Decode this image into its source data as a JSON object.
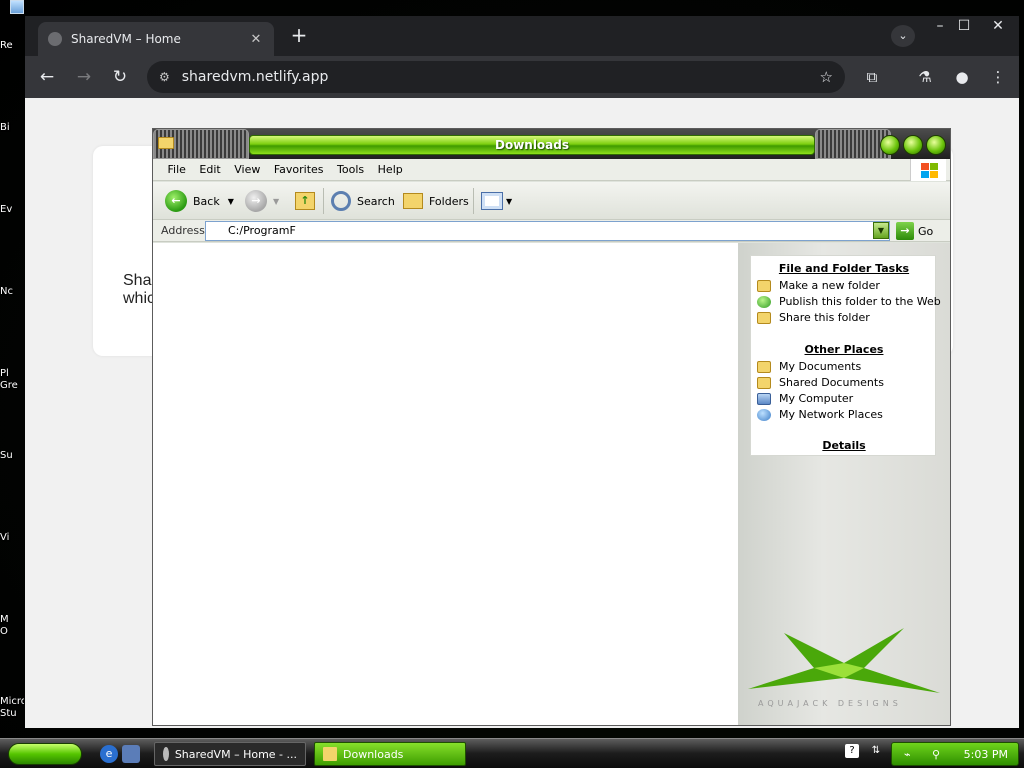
{
  "desktop": {
    "labels": [
      "Re",
      "Bi",
      "Ev",
      "Nc",
      "Pl",
      "Gre",
      "Su",
      "Vi",
      "M",
      "O",
      "Micro",
      "Stu"
    ]
  },
  "browser": {
    "tab_title": "SharedVM – Home",
    "url": "sharedvm.netlify.app",
    "page_text_line1": "Sha",
    "page_text_line2": "whic"
  },
  "explorer": {
    "title": "Downloads",
    "menus": [
      "File",
      "Edit",
      "View",
      "Favorites",
      "Tools",
      "Help"
    ],
    "toolbar": {
      "back": "Back",
      "search": "Search",
      "folders": "Folders"
    },
    "address_label": "Address",
    "address_value": "C:/ProgramF",
    "go_label": "Go",
    "tasks_header": "File and Folder Tasks",
    "tasks": [
      "Make a new folder",
      "Publish this folder to the Web",
      "Share this folder"
    ],
    "places_header": "Other Places",
    "places": [
      "My Documents",
      "Shared Documents",
      "My Computer",
      "My Network Places"
    ],
    "details_header": "Details",
    "brand": "AQUAJACK DESIGNS"
  },
  "taskbar": {
    "items": [
      "SharedVM – Home - ...",
      "Downloads"
    ],
    "clock": "5:03 PM"
  },
  "colors": {
    "accent_green": "#55c500",
    "chrome_dark": "#202124"
  }
}
